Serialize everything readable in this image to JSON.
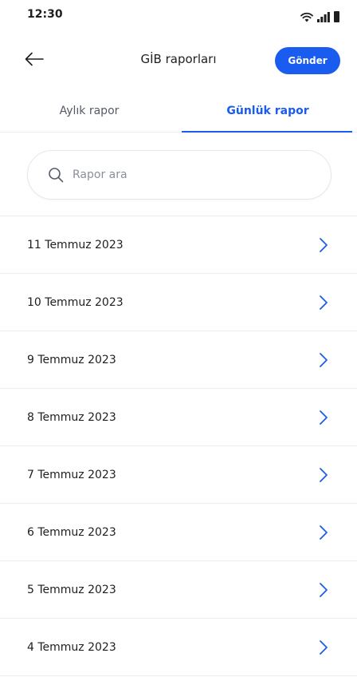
{
  "status_bar": {
    "time": "12:30",
    "icons": [
      "wifi-icon",
      "signal-icon",
      "battery-icon"
    ]
  },
  "header": {
    "title": "GİB raporları",
    "send_label": "Gönder",
    "back_icon": "arrow-left-icon"
  },
  "tabs": [
    {
      "label": "Aylık rapor",
      "active": false
    },
    {
      "label": "Günlük rapor",
      "active": true
    }
  ],
  "search": {
    "placeholder": "Rapor ara",
    "value": "",
    "icon": "search-icon"
  },
  "reports": [
    {
      "date": "11 Temmuz 2023"
    },
    {
      "date": "10 Temmuz 2023"
    },
    {
      "date": "9 Temmuz 2023"
    },
    {
      "date": "8 Temmuz 2023"
    },
    {
      "date": "7 Temmuz 2023"
    },
    {
      "date": "6 Temmuz 2023"
    },
    {
      "date": "5 Temmuz 2023"
    },
    {
      "date": "4 Temmuz 2023"
    }
  ],
  "colors": {
    "accent": "#1a5cf0",
    "text": "#1e1e1e",
    "muted": "#555a66",
    "divider": "#ececec"
  }
}
